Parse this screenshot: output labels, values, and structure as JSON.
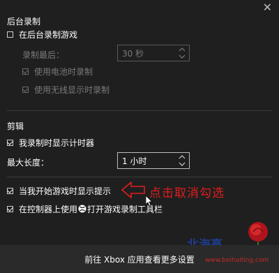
{
  "window": {
    "close_glyph": "✕"
  },
  "background_recording": {
    "title": "后台录制",
    "record_in_background": {
      "label": "在后台录制游戏",
      "checked": false
    },
    "record_last": {
      "label": "录制最后：",
      "value": "30 秒",
      "disabled": true
    },
    "use_battery": {
      "label": "使用电池时录制",
      "checked": true,
      "disabled": true
    },
    "use_wireless_display": {
      "label": "使用无线显示时录制",
      "checked": true,
      "disabled": true
    }
  },
  "clips": {
    "title": "剪辑",
    "show_timer": {
      "label": "我录制时显示计时器",
      "checked": true
    },
    "max_length": {
      "label": "最大长度：",
      "value": "1 小时"
    }
  },
  "tips": {
    "show_tips_on_start": {
      "label": "当我开始游戏时显示提示",
      "checked": true
    },
    "use_controller": {
      "label_before": "在控制器上使用",
      "label_after": "打开游戏录制工具栏",
      "checked": true,
      "icon": "xbox-logo-icon"
    }
  },
  "annotation": {
    "text": "点击取消勾选",
    "color": "#e11d1d"
  },
  "footer": {
    "link": "前往 Xbox 应用查看更多设置"
  },
  "watermark": {
    "brand": "北海亭",
    "url": "www.beihaiting.com",
    "brand_color": "#1f3c8f",
    "url_color": "#c62828"
  },
  "colors": {
    "background": "#1f1f1f",
    "text": "#ffffff",
    "disabled_text": "#7a7a7a",
    "footer_bg": "#2a2a2a"
  }
}
